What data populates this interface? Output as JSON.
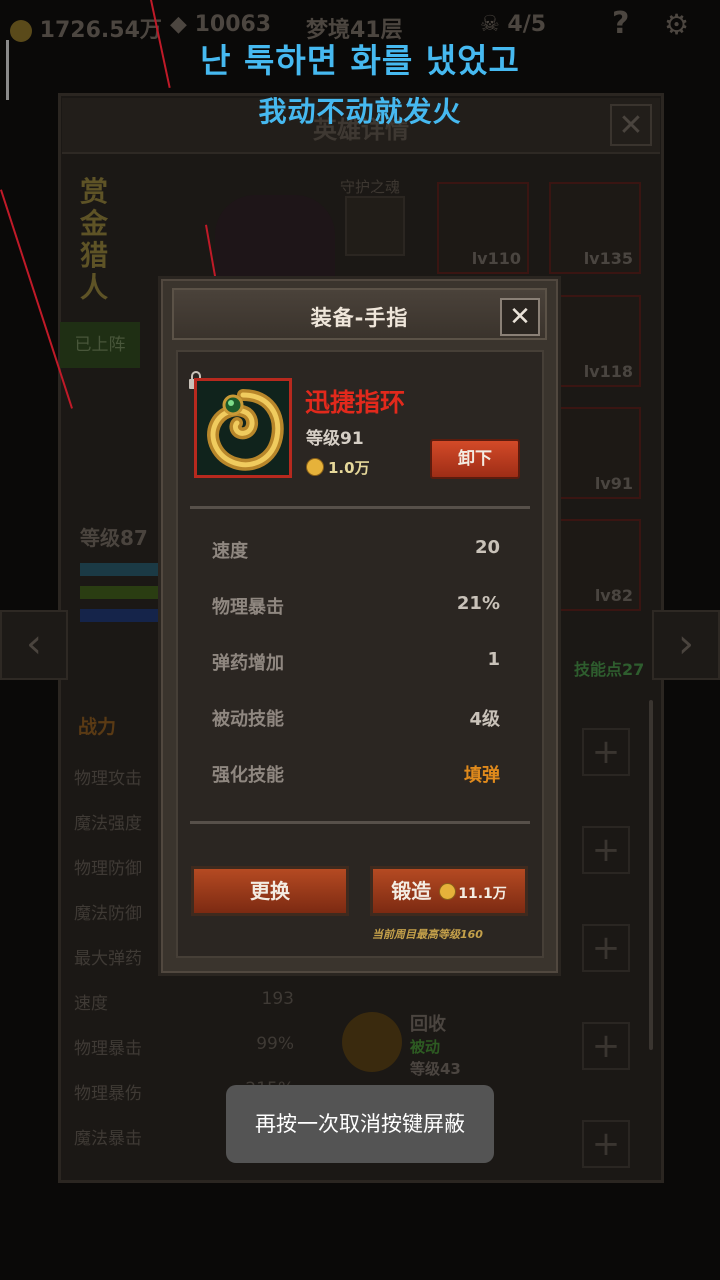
{
  "topbar": {
    "gold": "1726.54万",
    "gems": "10063",
    "floor": "梦境41层",
    "kills": "4/5",
    "help": "?"
  },
  "subtitles": {
    "line1": "난 툭하면 화를 냈었고",
    "line2": "我动不动就发火"
  },
  "hero_panel": {
    "title": "英雄详情",
    "close": "✕",
    "hero_name": "赏金猎人",
    "on_team": "已上阵",
    "guard_label": "守护之魂",
    "level": "等级87",
    "equip_slots": [
      {
        "level": "lv110"
      },
      {
        "level": "lv135"
      },
      {
        "level": "lv118"
      },
      {
        "level": "lv91"
      },
      {
        "level": "lv82"
      }
    ],
    "arrow_left": "‹",
    "arrow_right": "›",
    "skill_points": "技能点27",
    "stats_tab": "战力",
    "stats": [
      {
        "label": "物理攻击",
        "value": ""
      },
      {
        "label": "魔法强度",
        "value": ""
      },
      {
        "label": "物理防御",
        "value": ""
      },
      {
        "label": "魔法防御",
        "value": ""
      },
      {
        "label": "最大弹药",
        "value": ""
      },
      {
        "label": "速度",
        "value": "193"
      },
      {
        "label": "物理暴击",
        "value": "99%"
      },
      {
        "label": "物理暴伤",
        "value": "215%"
      },
      {
        "label": "魔法暴击",
        "value": ""
      }
    ],
    "skill": {
      "name": "回收",
      "type": "被动",
      "level": "等级43"
    },
    "plus": "+"
  },
  "dialog": {
    "title": "装备-手指",
    "close": "✕",
    "item_name": "迅捷指环",
    "item_level": "等级91",
    "item_price": "1.0万",
    "unequip": "卸下",
    "props": [
      {
        "label": "速度",
        "value": "20"
      },
      {
        "label": "物理暴击",
        "value": "21%"
      },
      {
        "label": "弹药增加",
        "value": "1"
      },
      {
        "label": "被动技能",
        "value": "4级"
      },
      {
        "label": "强化技能",
        "value": "填弹"
      }
    ],
    "replace": "更换",
    "forge": "锻造",
    "forge_price": "11.1万",
    "note": "当前周目最高等级160"
  },
  "toast": "再按一次取消按键屏蔽",
  "colors": {
    "accent_red": "#e2291c",
    "subtitle_blue": "#46b9f0",
    "button_red": "#b54a22",
    "highlight_orange": "#e08a1c"
  }
}
